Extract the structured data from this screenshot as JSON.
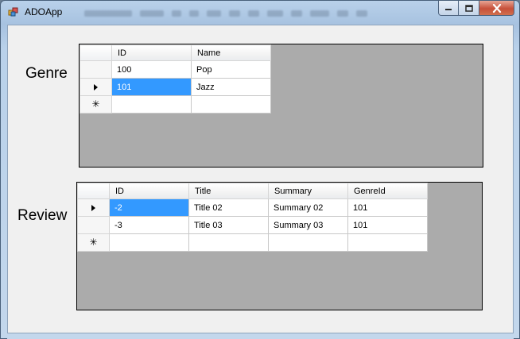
{
  "window": {
    "title": "ADOApp"
  },
  "genre": {
    "label": "Genre",
    "columns": [
      "ID",
      "Name"
    ],
    "rows": [
      {
        "id": "100",
        "name": "Pop",
        "selected": false
      },
      {
        "id": "101",
        "name": "Jazz",
        "selected": true
      }
    ]
  },
  "review": {
    "label": "Review",
    "columns": [
      "ID",
      "Title",
      "Summary",
      "GenreId"
    ],
    "rows": [
      {
        "id": "-2",
        "title": "Title 02",
        "summary": "Summary 02",
        "genreId": "101",
        "selected": true
      },
      {
        "id": "-3",
        "title": "Title 03",
        "summary": "Summary 03",
        "genreId": "101",
        "selected": false
      }
    ]
  },
  "colors": {
    "selection": "#3399ff",
    "grid_background": "#ababab",
    "form_background": "#f0f0f0"
  },
  "icons": {
    "current_row": "triangle-right-icon",
    "new_row": "asterisk-icon"
  }
}
